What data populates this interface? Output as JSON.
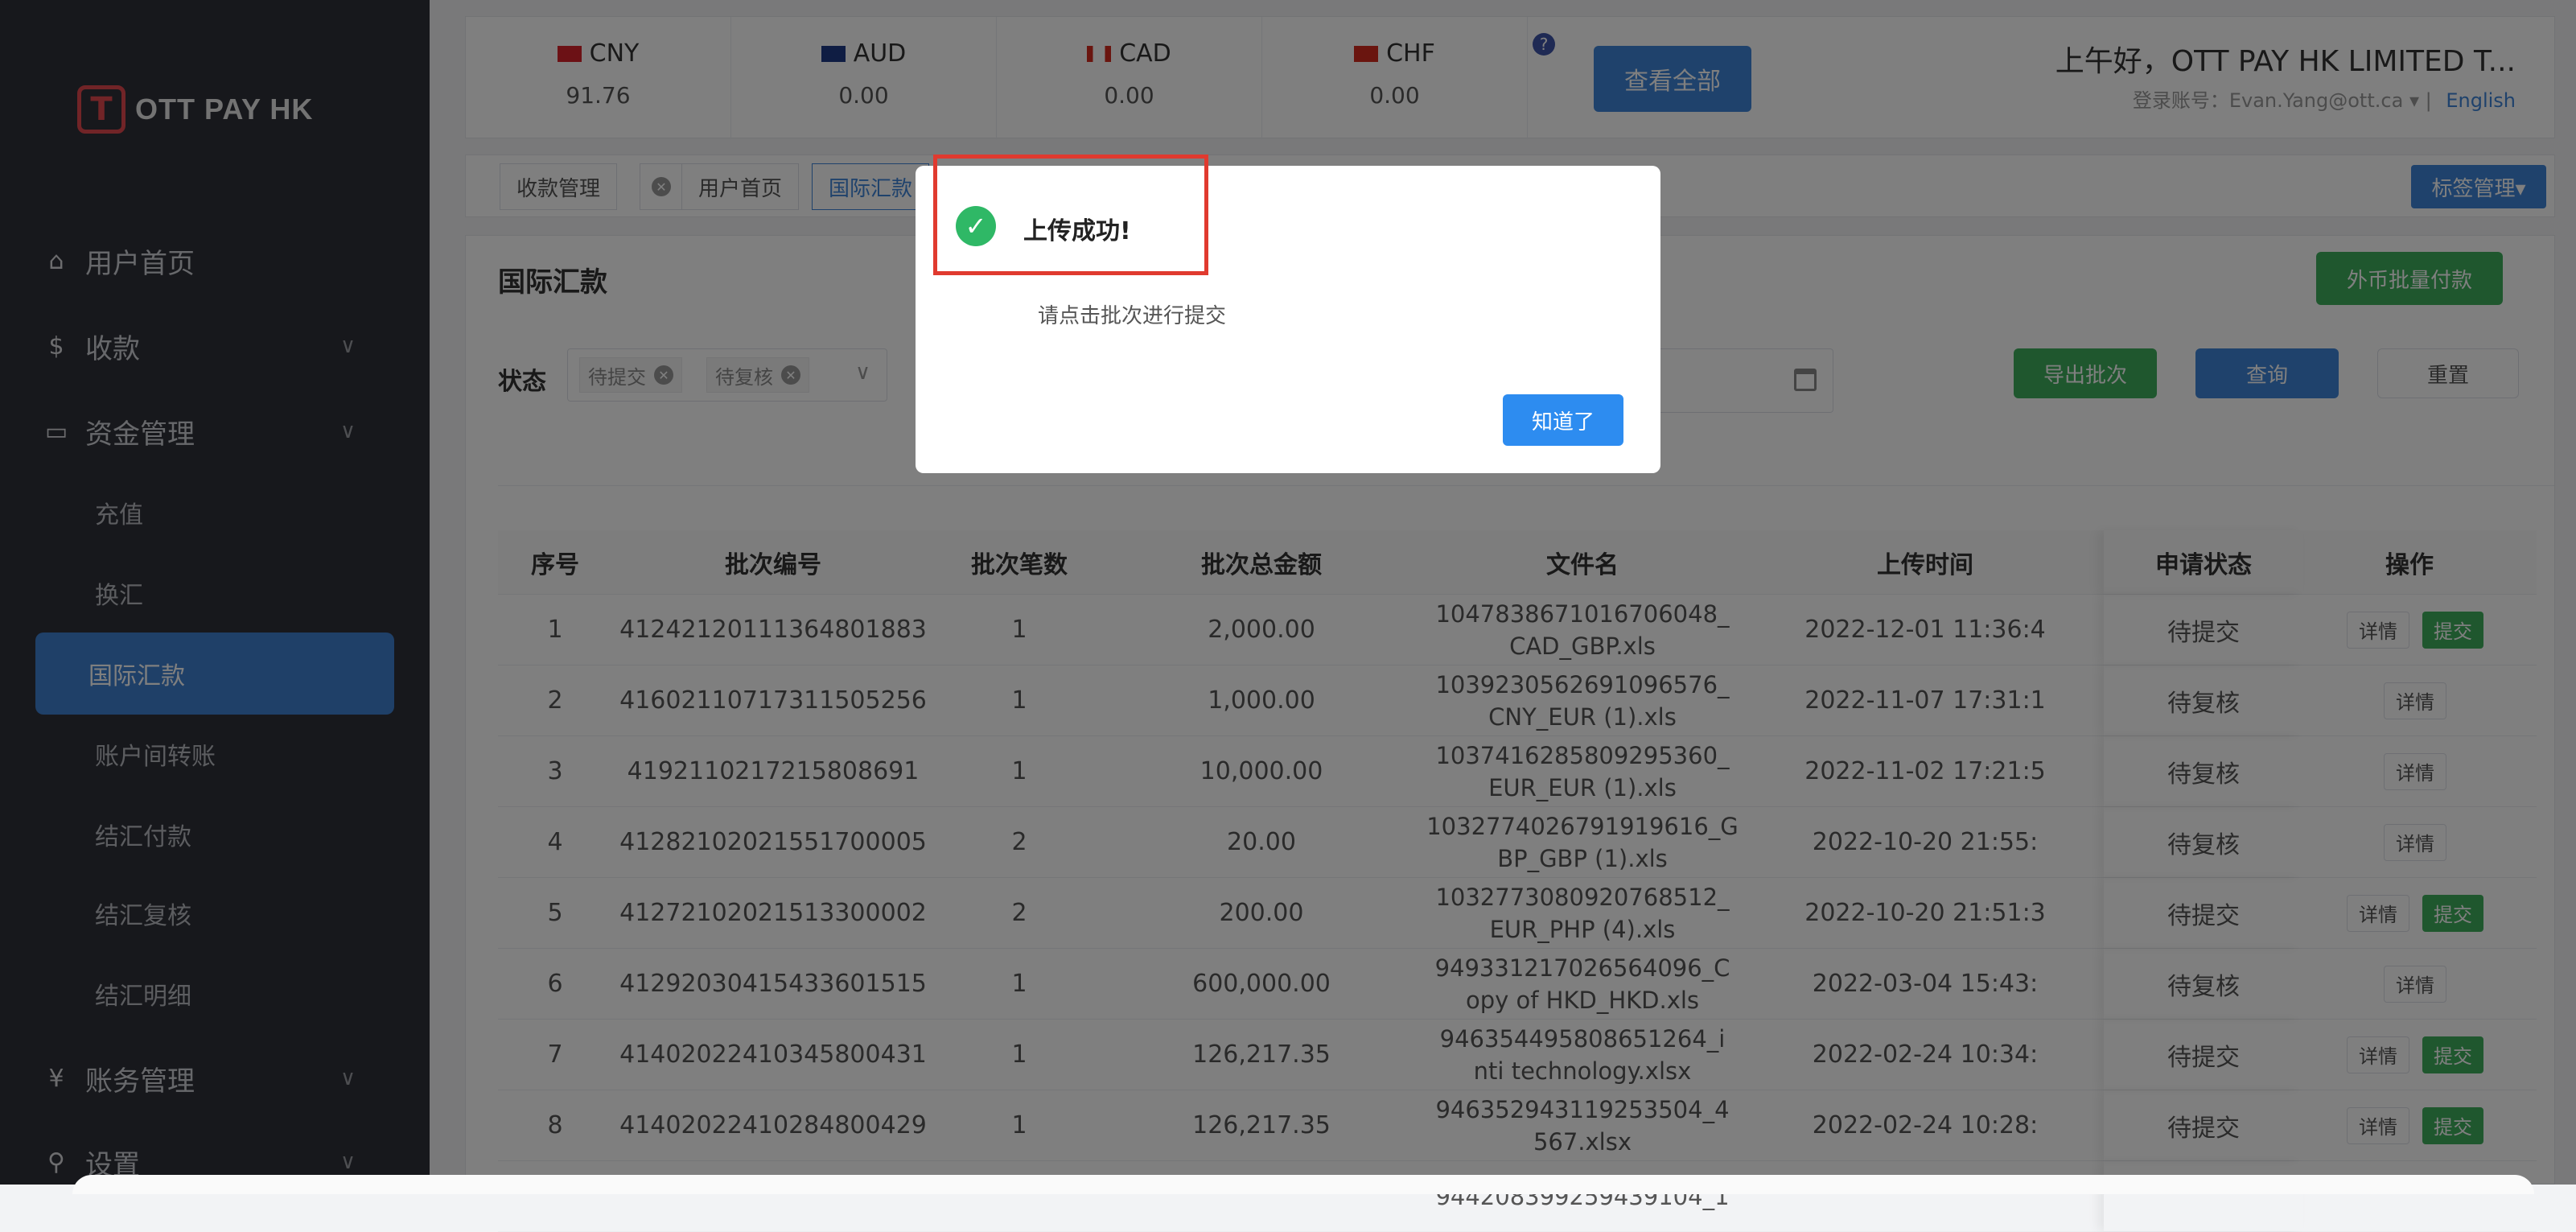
{
  "sidebar": {
    "logo_text": "OTT PAY HK",
    "items": [
      {
        "icon": "home-icon",
        "label": "用户首页"
      },
      {
        "icon": "dollar-icon",
        "label": "收款"
      },
      {
        "icon": "card-icon",
        "label": "资金管理"
      },
      {
        "icon": "yen-icon",
        "label": "账务管理"
      },
      {
        "icon": "search-icon",
        "label": "设置"
      }
    ],
    "sub_items": [
      "充值",
      "换汇",
      "国际汇款",
      "账户间转账",
      "结汇付款",
      "结汇复核",
      "结汇明细"
    ]
  },
  "balances": [
    {
      "code": "CNY",
      "value": "91.76"
    },
    {
      "code": "AUD",
      "value": "0.00"
    },
    {
      "code": "CAD",
      "value": "0.00"
    },
    {
      "code": "CHF",
      "value": "0.00"
    }
  ],
  "header": {
    "help_label": "?",
    "view_all": "查看全部",
    "greeting": "上午好，OTT PAY HK LIMITED T...",
    "account_label": "登录账号：",
    "account": "Evan.Yang@ott.ca",
    "language": "English"
  },
  "tags": [
    "收款管理",
    "用户首页",
    "国际汇款"
  ],
  "tag_manage": "标签管理▾",
  "page": {
    "title": "国际汇款",
    "batch_pay": "外币批量付款",
    "status_label": "状态",
    "status_chips": [
      "待提交",
      "待复核"
    ],
    "export": "导出批次",
    "query": "查询",
    "reset": "重置"
  },
  "table": {
    "columns": [
      "序号",
      "批次编号",
      "批次笔数",
      "批次总金额",
      "文件名",
      "上传时间",
      "申请状态",
      "操作"
    ],
    "rows": [
      {
        "idx": "1",
        "batch": "41242120111364801883",
        "count": "1",
        "amount": "2,000.00",
        "file": "1047838671016706048_\nCAD_GBP.xls",
        "time": "2022-12-01 11:36:4",
        "status": "待提交",
        "detail": "详情",
        "submit": "提交"
      },
      {
        "idx": "2",
        "batch": "41602110717311505256",
        "count": "1",
        "amount": "1,000.00",
        "file": "1039230562691096576_\nCNY_EUR (1).xls",
        "time": "2022-11-07 17:31:1",
        "status": "待复核",
        "detail": "详情",
        "submit": ""
      },
      {
        "idx": "3",
        "batch": "419211021721580869​1",
        "count": "1",
        "amount": "10,000.00",
        "file": "1037416285809295360_\nEUR_EUR (1).xls",
        "time": "2022-11-02 17:21:5",
        "status": "待复核",
        "detail": "详情",
        "submit": ""
      },
      {
        "idx": "4",
        "batch": "41282102021551700005",
        "count": "2",
        "amount": "20.00",
        "file": "1032774026791919616_G\nBP_GBP (1).xls",
        "time": "2022-10-20 21:55:",
        "status": "待复核",
        "detail": "详情",
        "submit": ""
      },
      {
        "idx": "5",
        "batch": "41272102021513300002",
        "count": "2",
        "amount": "200.00",
        "file": "1032773080920768512_\nEUR_PHP (4).xls",
        "time": "2022-10-20 21:51:3",
        "status": "待提交",
        "detail": "详情",
        "submit": "提交"
      },
      {
        "idx": "6",
        "batch": "41292030415433601515",
        "count": "1",
        "amount": "600,000.00",
        "file": "949331217026564096_C\nopy of HKD_HKD.xls",
        "time": "2022-03-04 15:43:",
        "status": "待复核",
        "detail": "详情",
        "submit": ""
      },
      {
        "idx": "7",
        "batch": "41402022410345800431",
        "count": "1",
        "amount": "126,217.35",
        "file": "946354495808651264_i\nnti technology.xlsx",
        "time": "2022-02-24 10:34:",
        "status": "待提交",
        "detail": "详情",
        "submit": "提交"
      },
      {
        "idx": "8",
        "batch": "41402022410284800429",
        "count": "1",
        "amount": "126,217.35",
        "file": "946352943119253504_4\n567.xlsx",
        "time": "2022-02-24 10:28:",
        "status": "待提交",
        "detail": "详情",
        "submit": "提交"
      },
      {
        "idx": "",
        "batch": "",
        "count": "",
        "amount": "",
        "file": "944208399259439104_1",
        "time": "",
        "status": "",
        "detail": "",
        "submit": ""
      }
    ]
  },
  "dialog": {
    "title": "上传成功!",
    "message": "请点击批次进行提交",
    "ok": "知道了"
  },
  "colors": {
    "sidebar_bg": "#2f3139",
    "accent_blue": "#3f85d8",
    "submit_green": "#3fae5d",
    "success_icon": "#2fb866",
    "highlight_red": "#e03a2f"
  }
}
